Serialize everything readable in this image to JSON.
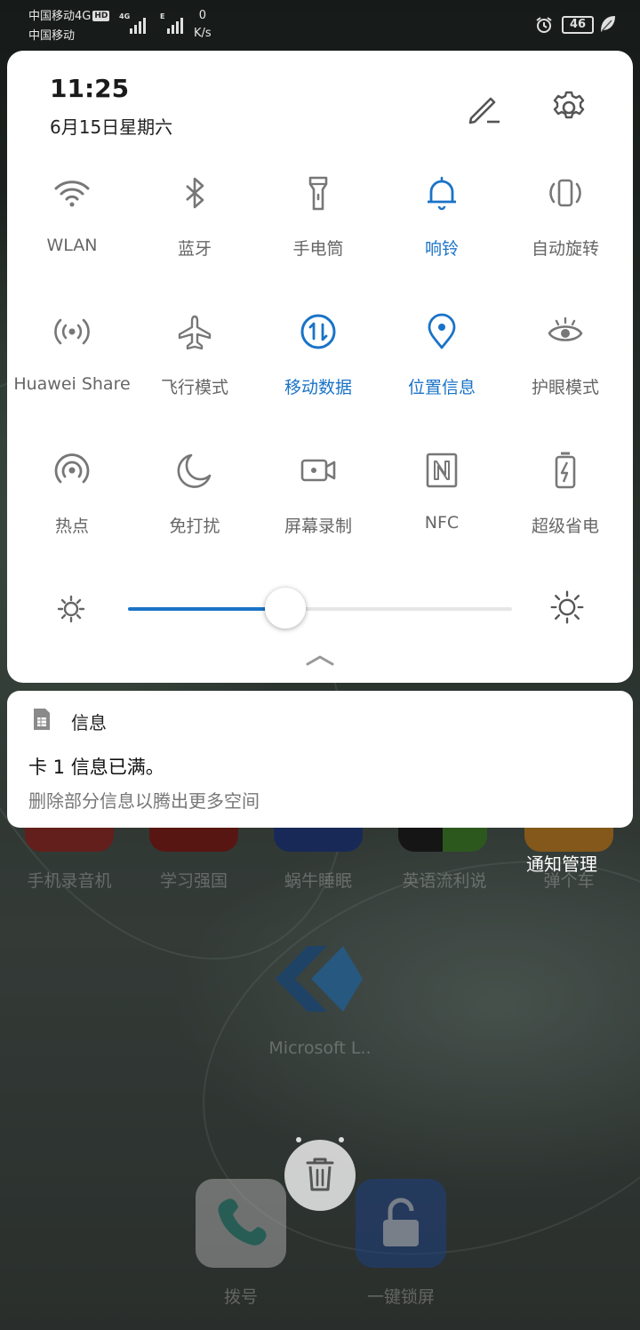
{
  "status_bar": {
    "carrier_line1": "中国移动4G",
    "hd_badge": "HD",
    "carrier_line2": "中国移动",
    "sig1_label": "4G",
    "sig2_label": "E",
    "speed_value": "0",
    "speed_unit": "K/s",
    "battery": "46"
  },
  "header": {
    "time": "11:25",
    "date": "6月15日星期六",
    "edit_icon": "pencil-icon",
    "settings_icon": "gear-icon"
  },
  "tiles": [
    {
      "label": "WLAN",
      "icon": "wifi-icon",
      "active": false
    },
    {
      "label": "蓝牙",
      "icon": "bluetooth-icon",
      "active": false
    },
    {
      "label": "手电筒",
      "icon": "flashlight-icon",
      "active": false
    },
    {
      "label": "响铃",
      "icon": "bell-icon",
      "active": true
    },
    {
      "label": "自动旋转",
      "icon": "rotate-icon",
      "active": false
    },
    {
      "label": "Huawei Share",
      "icon": "share-icon",
      "active": false
    },
    {
      "label": "飞行模式",
      "icon": "airplane-icon",
      "active": false
    },
    {
      "label": "移动数据",
      "icon": "mobile-data-icon",
      "active": true
    },
    {
      "label": "位置信息",
      "icon": "location-icon",
      "active": true
    },
    {
      "label": "护眼模式",
      "icon": "eye-icon",
      "active": false
    },
    {
      "label": "热点",
      "icon": "hotspot-icon",
      "active": false
    },
    {
      "label": "免打扰",
      "icon": "moon-icon",
      "active": false
    },
    {
      "label": "屏幕录制",
      "icon": "screen-record-icon",
      "active": false
    },
    {
      "label": "NFC",
      "icon": "nfc-icon",
      "active": false
    },
    {
      "label": "超级省电",
      "icon": "battery-saver-icon",
      "active": false
    }
  ],
  "brightness": {
    "level_fraction": 0.41
  },
  "colors": {
    "accent": "#1a73c7",
    "icon_gray": "#777777"
  },
  "notification": {
    "app": "信息",
    "title": "卡 1 信息已满。",
    "body": "删除部分信息以腾出更多空间"
  },
  "background": {
    "app_labels": [
      "手机录音机",
      "学习强国",
      "蜗牛睡眠",
      "英语流利说",
      "弹个车"
    ],
    "manage_label": "通知管理",
    "microsoft_label": "Microsoft L..",
    "dock_labels": [
      "拨号",
      "一键锁屏"
    ]
  }
}
